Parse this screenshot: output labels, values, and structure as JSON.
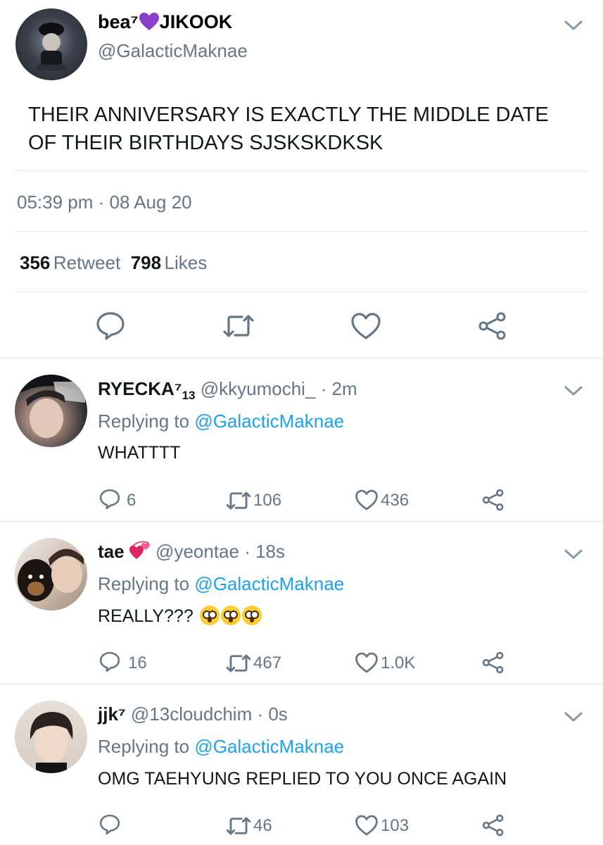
{
  "tweet": {
    "author_name": "bea⁷",
    "author_name_suffix": "JIKOOK",
    "author_handle": "@GalacticMaknae",
    "text_line1": "THEIR ANNIVERSARY IS EXACTLY THE MIDDLE DATE",
    "text_line2": "OF THEIR BIRTHDAYS SJSKSKDKSK",
    "timestamp": "05:39 pm · 08 Aug 20",
    "retweet_count": "356",
    "retweet_label": "Retweet",
    "like_count": "798",
    "like_label": "Likes"
  },
  "replies": [
    {
      "name": "RYECKA⁷",
      "name_sub": "13",
      "handle_time": "@kkyumochi_ · 2m",
      "replying_prefix": "Replying to",
      "replying_handle": "@GalacticMaknae",
      "text": "WHATTTT",
      "reply_count": "6",
      "retweet_count": "106",
      "like_count": "436"
    },
    {
      "name": "tae",
      "handle_time": "@yeontae · 18s",
      "replying_prefix": "Replying to",
      "replying_handle": "@GalacticMaknae",
      "text": "REALLY???",
      "reply_count": "16",
      "retweet_count": "467",
      "like_count": "1.0K"
    },
    {
      "name": "jjk⁷",
      "handle_time": "@13cloudchim · 0s",
      "replying_prefix": "Replying to",
      "replying_handle": "@GalacticMaknae",
      "text": "OMG TAEHYUNG REPLIED TO YOU ONCE AGAIN",
      "reply_count": "",
      "retweet_count": "46",
      "like_count": "103"
    }
  ],
  "colors": {
    "link": "#1da1f2",
    "secondary_text": "#657786",
    "divider": "#e1e8ed",
    "purple_heart": "#8a3fc7"
  },
  "icons": [
    "chevron-down-icon",
    "reply-icon",
    "retweet-icon",
    "like-icon",
    "share-icon",
    "purple-heart-emoji",
    "revolving-hearts-emoji",
    "astonished-face-emoji"
  ]
}
